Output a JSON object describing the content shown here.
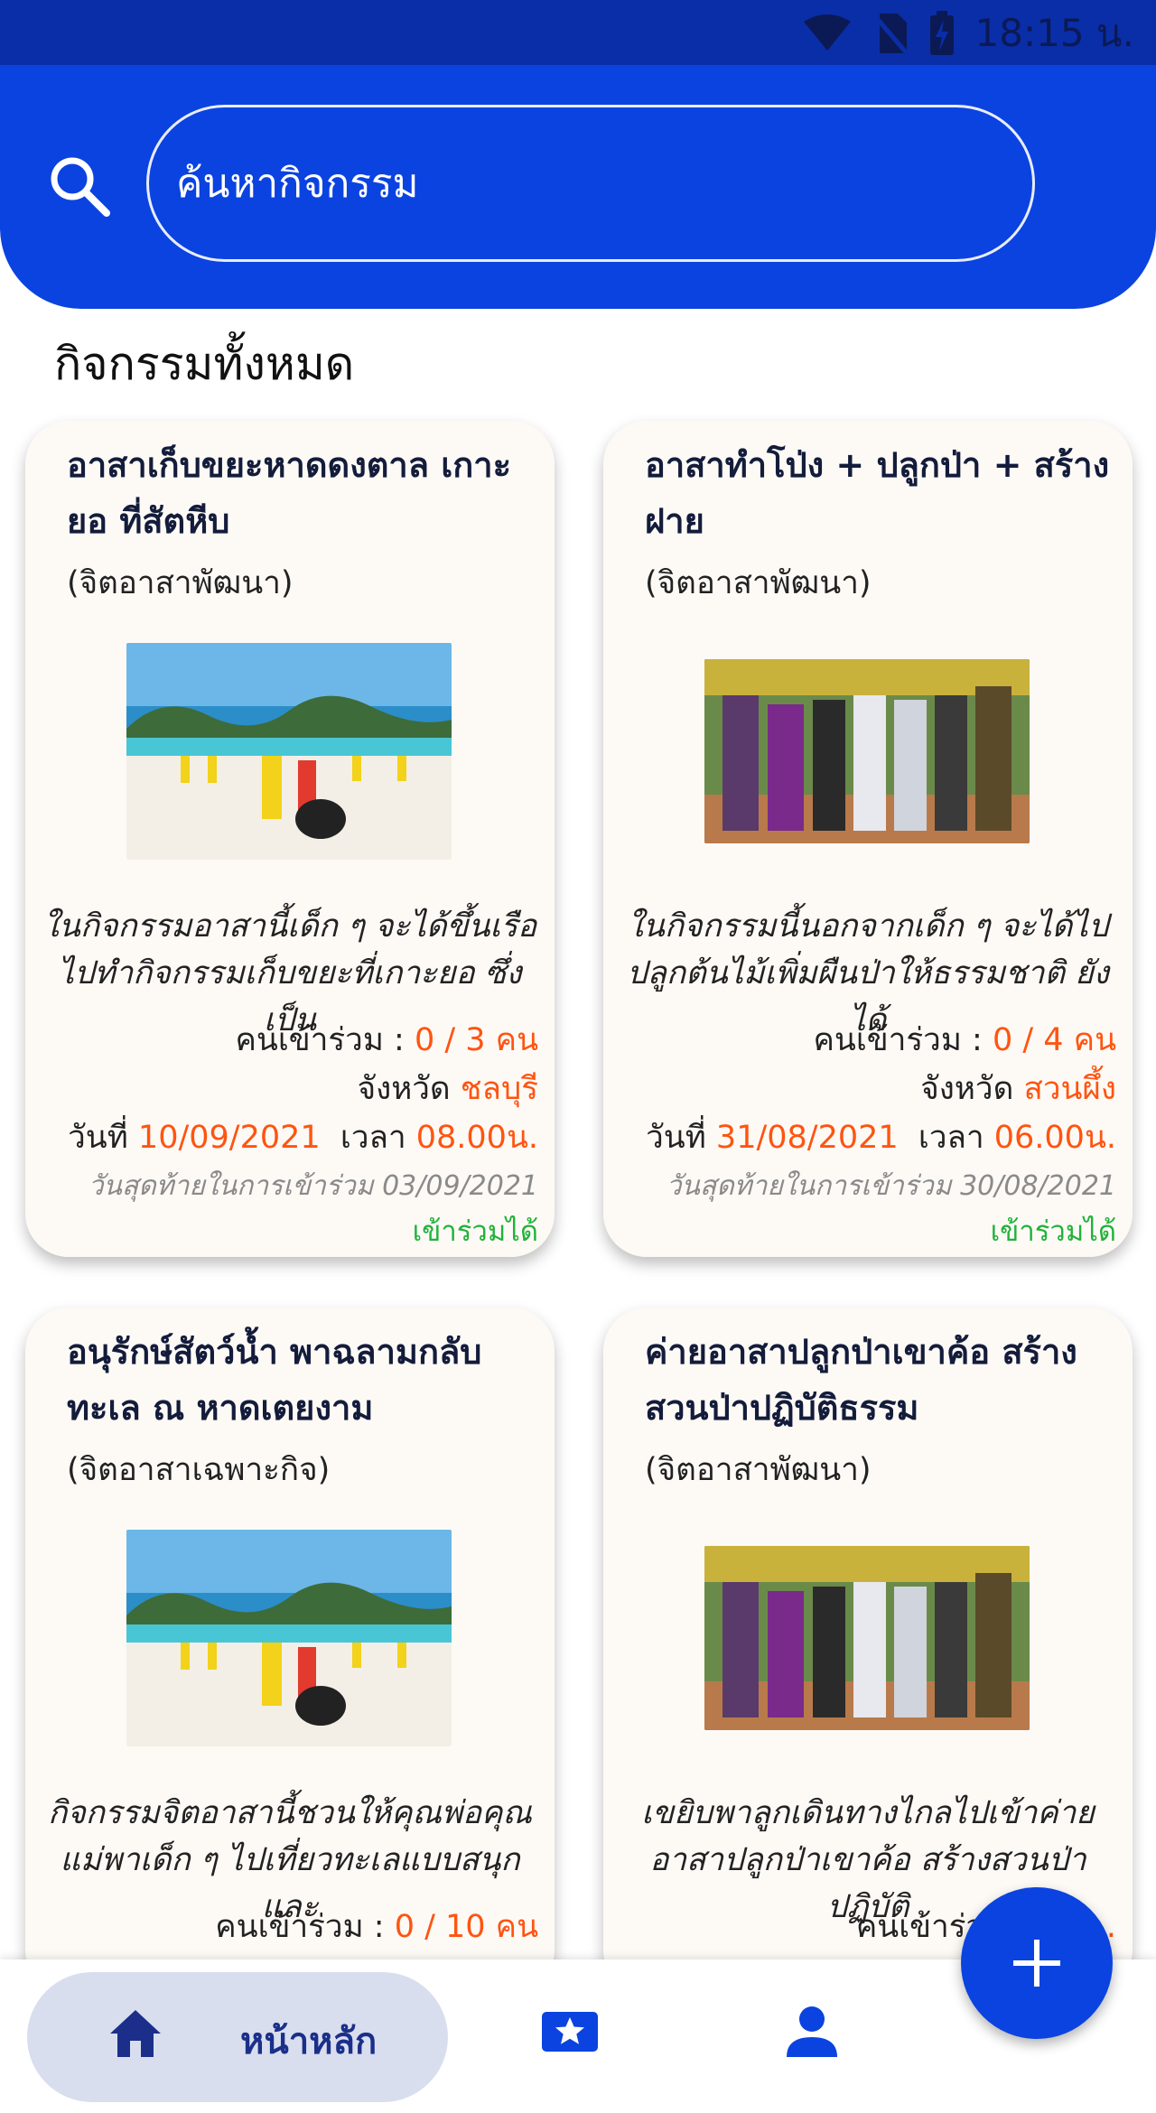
{
  "status_bar": {
    "time": "18:15 น."
  },
  "search": {
    "placeholder": "ค้นหากิจกรรม"
  },
  "section_title": "กิจกรรมทั้งหมด",
  "cards": [
    {
      "title": "อาสาเก็บขยะหาดดงตาล เกาะยอ ที่สัตหีบ",
      "type": "(จิตอาสาพัฒนา)",
      "desc_line1": "ในกิจกรรมอาสานี้เด็ก ๆ จะได้ขึ้นเรือ",
      "desc_line2": "ไปทำกิจกรรมเก็บขยะที่เกาะยอ ซึ่งเป็น",
      "participants_label": "คนเข้าร่วม : ",
      "participants": "0 / 3 คน",
      "province_label": "จังหวัด ",
      "province": "ชลบุรี",
      "date_label": "วันที่ ",
      "date": "10/09/2021",
      "time_label": "  เวลา ",
      "time": "08.00น.",
      "deadline": "วันสุดท้ายในการเข้าร่วม 03/09/2021",
      "join_status": "เข้าร่วมได้"
    },
    {
      "title": "อาสาทำโป่ง + ปลูกป่า + สร้างฝาย",
      "type": "(จิตอาสาพัฒนา)",
      "desc_line1": "ในกิจกรรมนี้นอกจากเด็ก ๆ จะได้ไป",
      "desc_line2": "ปลูกต้นไม้เพิ่มผืนป่าให้ธรรมชาติ ยังได้",
      "participants_label": "คนเข้าร่วม : ",
      "participants": "0 / 4 คน",
      "province_label": "จังหวัด ",
      "province": "สวนผึ้ง",
      "date_label": "วันที่ ",
      "date": "31/08/2021",
      "time_label": "  เวลา ",
      "time": "06.00น.",
      "deadline": "วันสุดท้ายในการเข้าร่วม 30/08/2021",
      "join_status": "เข้าร่วมได้"
    },
    {
      "title": "อนุรักษ์สัตว์น้ำ พาฉลามกลับทะเล ณ หาดเตยงาม",
      "type": "(จิตอาสาเฉพาะกิจ)",
      "desc_line1": "กิจกรรมจิตอาสานี้ชวนให้คุณพ่อคุณ",
      "desc_line2": "แม่พาเด็ก ๆ ไปเที่ยวทะเลแบบสนุกและ",
      "participants_label": "คนเข้าร่วม : ",
      "participants": "0 / 10 คน"
    },
    {
      "title": "ค่ายอาสาปลูกป่าเขาค้อ สร้างสวนป่าปฏิบัติธรรม",
      "type": "(จิตอาสาพัฒนา)",
      "desc_line1": "เขยิบพาลูกเดินทางไกลไปเข้าค่าย",
      "desc_line2": "อาสาปลูกป่าเขาค้อ สร้างสวนป่าปฏิบัติ",
      "participants_label": "คนเข้าร่วม : ",
      "participants": "0 / ..."
    }
  ],
  "bottom_nav": {
    "home_label": "หน้าหลัก"
  },
  "colors": {
    "primary": "#0b43e0",
    "accent_orange": "#ff5410",
    "success_green": "#21b23a"
  }
}
